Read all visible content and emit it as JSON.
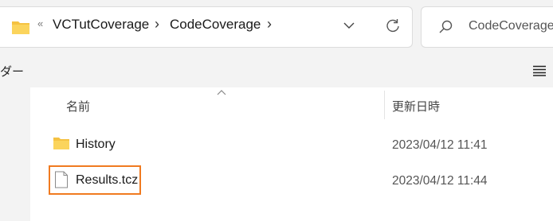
{
  "address_bar": {
    "overflow_glyph": "«",
    "crumbs": [
      "VCTutCoverage",
      "CodeCoverage"
    ],
    "separator": "›"
  },
  "search": {
    "placeholder": "CodeCoverage"
  },
  "toolbar": {
    "label": "ダー"
  },
  "columns": {
    "name": "名前",
    "date_modified": "更新日時"
  },
  "files": [
    {
      "name": "History",
      "date": "2023/04/12 11:41",
      "type": "folder"
    },
    {
      "name": "Results.tcz",
      "date": "2023/04/12 11:44",
      "type": "file"
    }
  ],
  "colors": {
    "folder": "#f5c242",
    "highlight": "#f07a20"
  }
}
